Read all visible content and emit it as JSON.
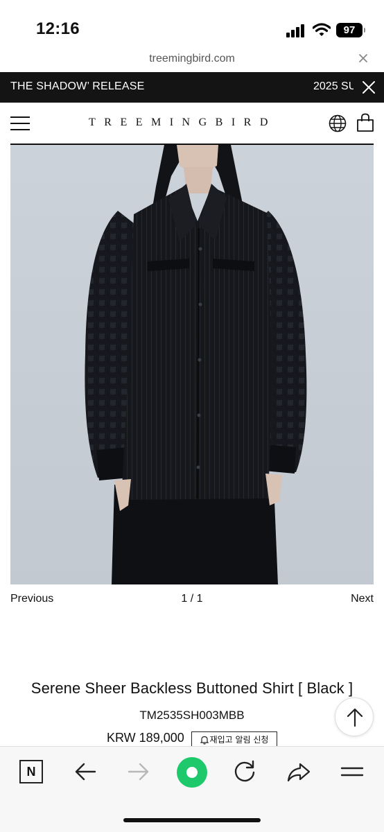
{
  "status_bar": {
    "time": "12:16",
    "battery": "97",
    "icons": [
      "signal-icon",
      "wifi-icon",
      "battery-icon"
    ]
  },
  "browser": {
    "url": "treemingbird.com",
    "close_icon": "close-icon"
  },
  "announcement": {
    "left_text": "THE SHADOW’ RELEASE",
    "right_text": "2025 SU",
    "close_icon": "close-icon"
  },
  "header": {
    "logo": "TREEMINGBIRD",
    "icons": [
      "hamburger-menu-icon",
      "globe-icon",
      "shopping-bag-icon"
    ]
  },
  "gallery": {
    "prev_label": "Previous",
    "counter": "1 / 1",
    "next_label": "Next"
  },
  "product": {
    "title": "Serene Sheer Backless Buttoned Shirt [ Black ]",
    "code": "TM2535SH003MBB",
    "price": "KRW 189,000",
    "restock_label": "재입고 알림 신청"
  },
  "toolbar": {
    "items": [
      "naver-home-icon",
      "back-arrow-icon",
      "forward-arrow-icon",
      "green-dot-icon",
      "reload-icon",
      "share-icon",
      "menu-icon"
    ],
    "naver_label": "N"
  },
  "colors": {
    "announcement_bg": "#141414",
    "green_accent": "#1ec96b",
    "toolbar_bg": "#f7f7f7"
  }
}
